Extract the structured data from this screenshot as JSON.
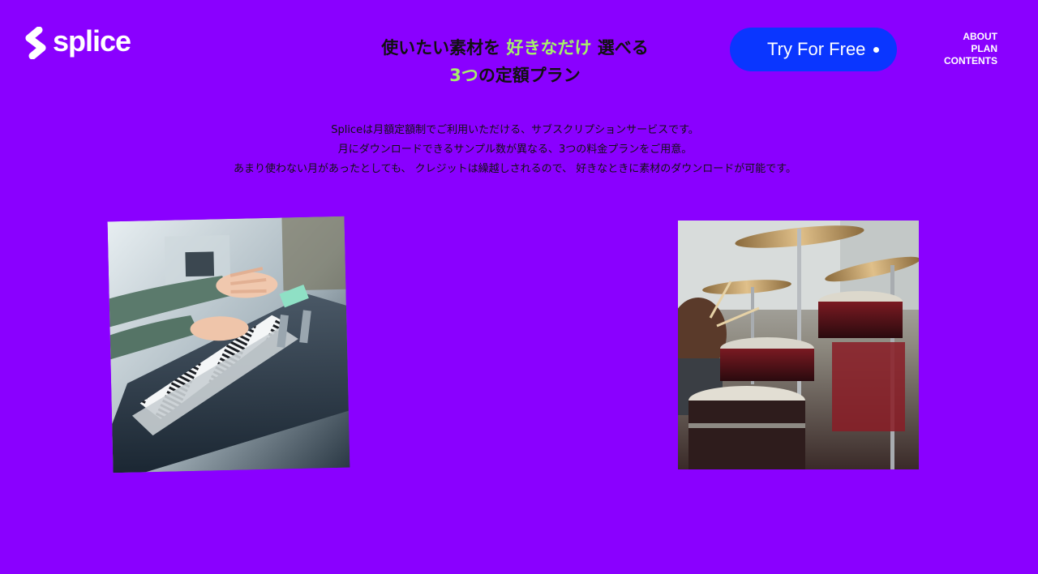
{
  "brand": {
    "name": "splice",
    "logo_icon": "splice-s-logo-icon",
    "background_color": "#8a00ff",
    "highlight_color": "#a6f06a",
    "cta_color": "#0a36ff"
  },
  "headline": {
    "line1_part1": "使いたい素材を ",
    "line1_highlight": "好きなだけ",
    "line1_part2": " 選べる",
    "line2_highlight": "3つ",
    "line2_part": "の定額プラン"
  },
  "cta": {
    "label": "Try For Free",
    "indicator_icon": "dot-icon"
  },
  "nav": {
    "items": [
      {
        "label": "ABOUT"
      },
      {
        "label": "PLAN"
      },
      {
        "label": "CONTENTS"
      }
    ]
  },
  "description": {
    "lines": [
      "Spliceは月額定額制でご利用いただける、サブスクリプションサービスです。",
      "月にダウンロードできるサンプル数が異なる、3つの料金プランをご用意。",
      "あまり使わない月があったとしても、 クレジットは繰越しされるので、 好きなときに素材のダウンロードが可能です。"
    ]
  },
  "images": [
    {
      "subject": "keyboard-player-photo"
    },
    {
      "subject": "drum-kit-photo"
    }
  ]
}
